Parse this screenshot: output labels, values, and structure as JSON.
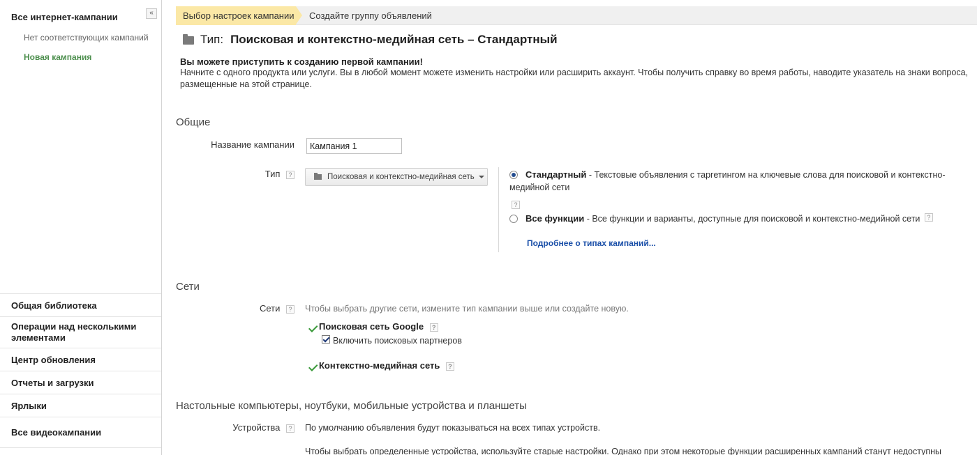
{
  "sidebar": {
    "collapse_icon": "«",
    "all_campaigns": "Все интернет-кампании",
    "no_matching": "Нет соответствующих кампаний",
    "new_campaign": "Новая кампания",
    "items": [
      {
        "label": "Общая библиотека"
      },
      {
        "label": "Операции над несколькими элементами"
      },
      {
        "label": "Центр обновления"
      },
      {
        "label": "Отчеты и загрузки"
      },
      {
        "label": "Ярлыки"
      },
      {
        "label": "Все видеокампании"
      }
    ]
  },
  "steps": {
    "active": "Выбор настроек кампании",
    "next": "Создайте группу объявлений"
  },
  "type_header": {
    "label": "Тип:",
    "value": "Поисковая и контекстно-медийная сеть – Стандартный"
  },
  "intro": {
    "bold": "Вы можете приступить к созданию первой кампании!",
    "text": "Начните с одного продукта или услуги. Вы в любой момент можете изменить настройки или расширить аккаунт. Чтобы получить справку во время работы, наводите указатель на знаки вопроса, размещенные на этой странице."
  },
  "general": {
    "title": "Общие",
    "name_label": "Название кампании",
    "name_value": "Кампания 1",
    "type_label": "Тип",
    "type_dropdown": "Поисковая и контекстно-медийная сеть",
    "options": {
      "standard_title": "Стандартный",
      "standard_desc": " - Текстовые объявления с таргетингом на ключевые слова для поисковой и контекстно-медийной сети",
      "all_title": "Все функции",
      "all_desc": " - Все функции и варианты, доступные для поисковой и контекстно-медийной сети"
    },
    "more_link": "Подробнее о типах кампаний..."
  },
  "networks": {
    "title": "Сети",
    "label": "Сети",
    "hint": "Чтобы выбрать другие сети, измените тип кампании выше или создайте новую.",
    "search": "Поисковая сеть Google",
    "partners": "Включить поисковых партнеров",
    "display": "Контекстно-медийная сеть"
  },
  "devices": {
    "title": "Настольные компьютеры, ноутбуки, мобильные устройства и планшеты",
    "label": "Устройства",
    "text1": "По умолчанию объявления будут показываться на всех типах устройств.",
    "text2": "Чтобы выбрать определенные устройства, используйте старые настройки. Однако при этом некоторые функции расширенных кампаний станут недоступны"
  },
  "help_icon": "?"
}
